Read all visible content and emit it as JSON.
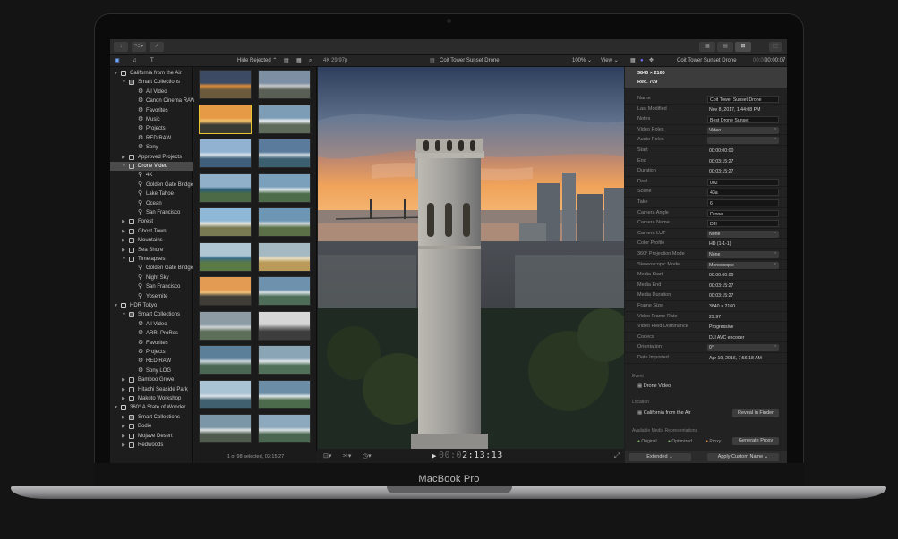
{
  "device": {
    "brand": "MacBook Pro"
  },
  "toolbar": {
    "left_buttons": [
      "↓",
      "⌥▾",
      "✓"
    ],
    "right_buttons": [
      "▦",
      "▤",
      "⊞",
      "⬚"
    ]
  },
  "subbar": {
    "hide_rejected": "Hide Rejected ⌃",
    "format": "4K 29.97p",
    "clip_title": "Coit Tower Sunset Drone",
    "zoom": "100% ⌄",
    "view": "View ⌄",
    "inspector_clip": "Coit Tower Sunset Drone",
    "inspector_time": "00:00:07",
    "inspector_time_dim": "00:00:"
  },
  "sidebar": {
    "items": [
      {
        "label": "California from the Air",
        "indent": 0,
        "icon": "library",
        "expanded": true
      },
      {
        "label": "Smart Collections",
        "indent": 1,
        "icon": "folder",
        "expanded": true
      },
      {
        "label": "All Video",
        "indent": 2,
        "icon": "gear"
      },
      {
        "label": "Canon Cinema RAW",
        "indent": 2,
        "icon": "gear"
      },
      {
        "label": "Favorites",
        "indent": 2,
        "icon": "gear"
      },
      {
        "label": "Music",
        "indent": 2,
        "icon": "gear"
      },
      {
        "label": "Projects",
        "indent": 2,
        "icon": "gear"
      },
      {
        "label": "RED RAW",
        "indent": 2,
        "icon": "gear"
      },
      {
        "label": "Sony",
        "indent": 2,
        "icon": "gear"
      },
      {
        "label": "Approved Projects",
        "indent": 1,
        "icon": "star",
        "expanded": false
      },
      {
        "label": "Drone Video",
        "indent": 1,
        "icon": "star",
        "expanded": true,
        "selected": true
      },
      {
        "label": "4K",
        "indent": 2,
        "icon": "keyword"
      },
      {
        "label": "Golden Gate Bridge",
        "indent": 2,
        "icon": "keyword"
      },
      {
        "label": "Lake Tahoe",
        "indent": 2,
        "icon": "keyword"
      },
      {
        "label": "Ocean",
        "indent": 2,
        "icon": "keyword"
      },
      {
        "label": "San Francisco",
        "indent": 2,
        "icon": "keyword"
      },
      {
        "label": "Forest",
        "indent": 1,
        "icon": "star",
        "expanded": false
      },
      {
        "label": "Ghost Town",
        "indent": 1,
        "icon": "star",
        "expanded": false
      },
      {
        "label": "Mountains",
        "indent": 1,
        "icon": "star",
        "expanded": false
      },
      {
        "label": "Sea Shore",
        "indent": 1,
        "icon": "star",
        "expanded": false
      },
      {
        "label": "Timelapses",
        "indent": 1,
        "icon": "star",
        "expanded": true
      },
      {
        "label": "Golden Gate Bridge",
        "indent": 2,
        "icon": "keyword"
      },
      {
        "label": "Night Sky",
        "indent": 2,
        "icon": "keyword"
      },
      {
        "label": "San Francisco",
        "indent": 2,
        "icon": "keyword"
      },
      {
        "label": "Yosemite",
        "indent": 2,
        "icon": "keyword"
      },
      {
        "label": "HDR Tokyo",
        "indent": 0,
        "icon": "library",
        "expanded": true
      },
      {
        "label": "Smart Collections",
        "indent": 1,
        "icon": "folder",
        "expanded": true
      },
      {
        "label": "All Video",
        "indent": 2,
        "icon": "gear"
      },
      {
        "label": "ARRI ProRes",
        "indent": 2,
        "icon": "gear"
      },
      {
        "label": "Favorites",
        "indent": 2,
        "icon": "gear"
      },
      {
        "label": "Projects",
        "indent": 2,
        "icon": "gear"
      },
      {
        "label": "RED RAW",
        "indent": 2,
        "icon": "gear"
      },
      {
        "label": "Sony LOG",
        "indent": 2,
        "icon": "gear"
      },
      {
        "label": "Bamboo Grove",
        "indent": 1,
        "icon": "star",
        "expanded": false
      },
      {
        "label": "Hitachi Seaside Park",
        "indent": 1,
        "icon": "star",
        "expanded": false
      },
      {
        "label": "Makoto Workshop",
        "indent": 1,
        "icon": "star",
        "expanded": false
      },
      {
        "label": "360° A State of Wonder",
        "indent": 0,
        "icon": "library",
        "expanded": true
      },
      {
        "label": "Smart Collections",
        "indent": 1,
        "icon": "folder",
        "expanded": false
      },
      {
        "label": "Bodie",
        "indent": 1,
        "icon": "star",
        "expanded": false
      },
      {
        "label": "Mojave Desert",
        "indent": 1,
        "icon": "star",
        "expanded": false
      },
      {
        "label": "Redwoods",
        "indent": 1,
        "icon": "star",
        "expanded": false
      }
    ]
  },
  "browser": {
    "status": "1 of 98 selected, 03:15:27",
    "thumbnails": [
      {
        "sky": "#3d4a63",
        "ground": "#6b5a3b",
        "accent": "#d98a3a"
      },
      {
        "sky": "#7d8fa3",
        "ground": "#5a5f55",
        "accent": "#c4c7c9"
      },
      {
        "sky": "#e79a46",
        "ground": "#3a3a35",
        "accent": "#f3c06a",
        "selected": true
      },
      {
        "sky": "#7d9cb6",
        "ground": "#5e6b5a",
        "accent": "#e9eef2"
      },
      {
        "sky": "#91b2d0",
        "ground": "#3f5f7a",
        "accent": "#d6e2ea"
      },
      {
        "sky": "#5a7b9c",
        "ground": "#3d6071",
        "accent": "#cbd8e0"
      },
      {
        "sky": "#8fb0c8",
        "ground": "#4b6a45",
        "accent": "#2b5d7a"
      },
      {
        "sky": "#7aa0bb",
        "ground": "#4c6c4a",
        "accent": "#dfe8ee"
      },
      {
        "sky": "#8fb7d6",
        "ground": "#7a7a52",
        "accent": "#e5e8e2"
      },
      {
        "sky": "#6d95b4",
        "ground": "#5b7046",
        "accent": "#cfd9df"
      },
      {
        "sky": "#b1c6d3",
        "ground": "#5a7a46",
        "accent": "#3a6c88"
      },
      {
        "sky": "#a5b9c2",
        "ground": "#b99a58",
        "accent": "#e8dcc0"
      },
      {
        "sky": "#e39a53",
        "ground": "#3f3d36",
        "accent": "#f2c27b"
      },
      {
        "sky": "#6e92ad",
        "ground": "#4d6d58",
        "accent": "#d7e1e6"
      },
      {
        "sky": "#8d9ba4",
        "ground": "#5d6f58",
        "accent": "#cfd4d6"
      },
      {
        "sky": "#d6d6d6",
        "ground": "#3d3d3d",
        "accent": "#8c8c8c"
      },
      {
        "sky": "#5c7f99",
        "ground": "#4a6753",
        "accent": "#cbd6dc"
      },
      {
        "sky": "#8aa5b5",
        "ground": "#50705a",
        "accent": "#e0e7ea"
      },
      {
        "sky": "#a9c2d4",
        "ground": "#40606f",
        "accent": "#d9e3e8"
      },
      {
        "sky": "#6b8da5",
        "ground": "#4c6b4d",
        "accent": "#dfe6ea"
      },
      {
        "sky": "#7b96a6",
        "ground": "#505a4f",
        "accent": "#e0e4e5"
      },
      {
        "sky": "#8da9bd",
        "ground": "#4a6550",
        "accent": "#d9e1e5"
      }
    ]
  },
  "viewer": {
    "timecode": "2:13:13",
    "timecode_dim": "00:0"
  },
  "inspector": {
    "resolution": "3840 × 2160",
    "colorspace": "Rec. 709",
    "fields": [
      {
        "label": "Name",
        "value": "Coit Tower Sunset Drone",
        "kind": "box"
      },
      {
        "label": "Last Modified",
        "value": "Nov 8, 2017, 1:44:08 PM",
        "kind": "plain"
      },
      {
        "label": "Notes",
        "value": "Best Drone Sunset",
        "kind": "box"
      },
      {
        "label": "Video Roles",
        "value": "Video",
        "kind": "pop"
      },
      {
        "label": "Audio Roles",
        "value": "",
        "kind": "pop"
      },
      {
        "label": "Start",
        "value": "00:00:00:00",
        "kind": "plain"
      },
      {
        "label": "End",
        "value": "00:03:15:27",
        "kind": "plain"
      },
      {
        "label": "Duration",
        "value": "00:03:15:27",
        "kind": "plain"
      },
      {
        "label": "Reel",
        "value": "002",
        "kind": "box"
      },
      {
        "label": "Scene",
        "value": "43a",
        "kind": "box"
      },
      {
        "label": "Take",
        "value": "6",
        "kind": "box"
      },
      {
        "label": "Camera Angle",
        "value": "Drone",
        "kind": "box"
      },
      {
        "label": "Camera Name",
        "value": "DJI",
        "kind": "box"
      },
      {
        "label": "Camera LUT",
        "value": "None",
        "kind": "pop"
      },
      {
        "label": "Color Profile",
        "value": "HD (1-1-1)",
        "kind": "plain"
      },
      {
        "label": "360° Projection Mode",
        "value": "None",
        "kind": "pop"
      },
      {
        "label": "Stereoscopic Mode",
        "value": "Monoscopic",
        "kind": "pop"
      },
      {
        "label": "Media Start",
        "value": "00:00:00:00",
        "kind": "plain"
      },
      {
        "label": "Media End",
        "value": "00:03:15:27",
        "kind": "plain"
      },
      {
        "label": "Media Duration",
        "value": "00:03:15:27",
        "kind": "plain"
      },
      {
        "label": "Frame Size",
        "value": "3840 × 2160",
        "kind": "plain"
      },
      {
        "label": "Video Frame Rate",
        "value": "29.97",
        "kind": "plain"
      },
      {
        "label": "Video Field Dominance",
        "value": "Progressive",
        "kind": "plain"
      },
      {
        "label": "Codecs",
        "value": "DJI AVC encoder",
        "kind": "plain"
      },
      {
        "label": "Orientation",
        "value": "0°",
        "kind": "pop"
      },
      {
        "label": "Date Imported",
        "value": "Apr 19, 2016, 7:56:18 AM",
        "kind": "plain"
      }
    ],
    "event_section": "Event",
    "event_value": "Drone Video",
    "location_section": "Location",
    "location_value": "California from the Air",
    "reveal_button": "Reveal in Finder",
    "representations_section": "Available Media Representations",
    "rep_original": "Original",
    "rep_optimized": "Optimized",
    "rep_proxy": "Proxy",
    "generate_proxy_button": "Generate Proxy",
    "extended_button": "Extended ⌄",
    "apply_button": "Apply Custom Name ⌄"
  }
}
